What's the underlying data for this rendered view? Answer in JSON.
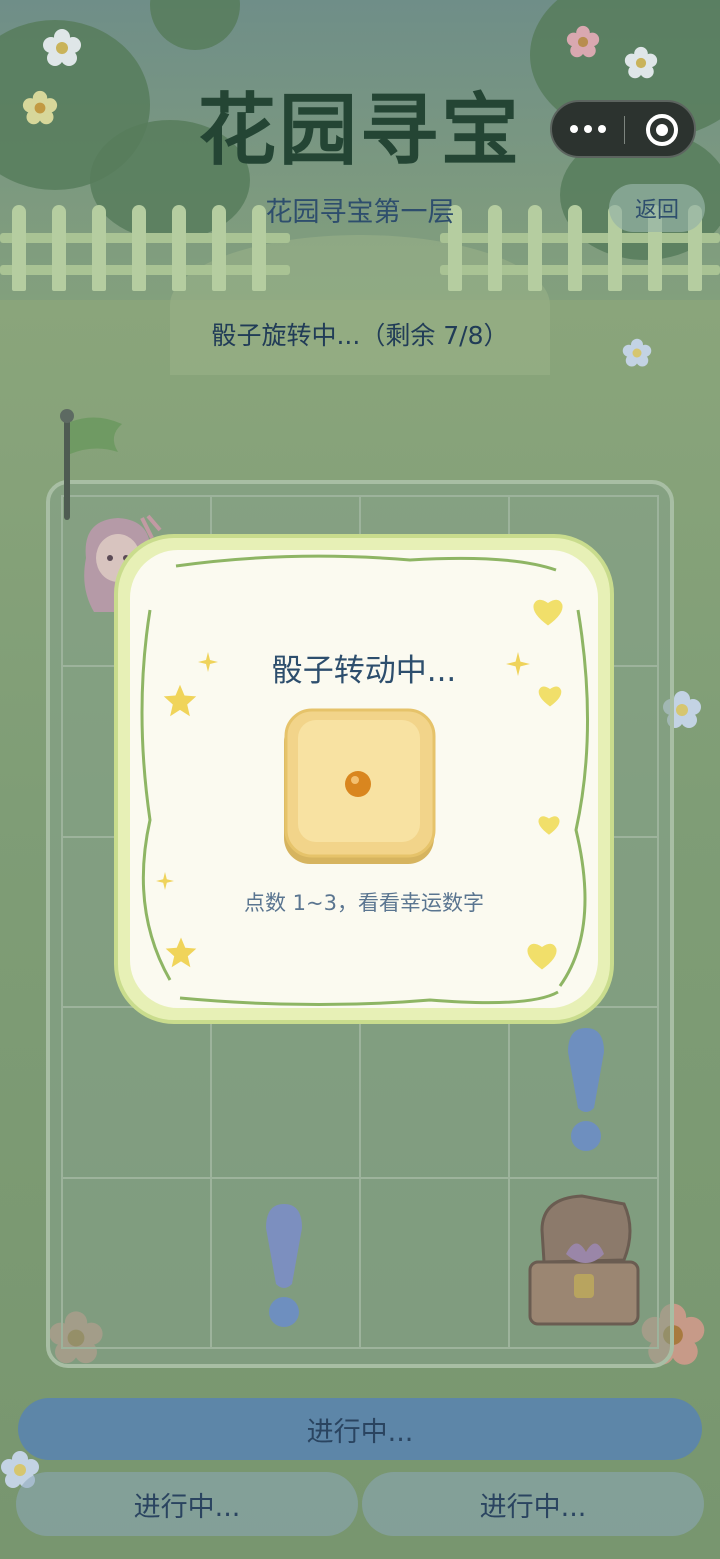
{
  "header": {
    "title": "花园寻宝",
    "subtitle": "花园寻宝第一层",
    "back_label": "返回"
  },
  "status_text": "骰子旋转中...（剩余 7/8）",
  "dice_panel": {
    "title": "骰子转动中...",
    "hint": "点数 1~3，看看幸运数字",
    "dice_face_value": 1
  },
  "board": {
    "columns": 4,
    "rows": 5
  },
  "buttons": {
    "main_label": "进行中...",
    "left_label": "进行中...",
    "right_label": "进行中..."
  },
  "icons": {
    "menu": "more-dots-icon",
    "close": "target-circle-icon",
    "flag": "flag-icon",
    "chest": "treasure-chest-icon",
    "exclaim": "exclamation-icon"
  },
  "colors": {
    "title": "#244534",
    "text_blue": "#2e4e6d",
    "button_main": "#5d86a8",
    "panel_bg": "#fbfaf0",
    "panel_border": "#e3eeb5"
  }
}
